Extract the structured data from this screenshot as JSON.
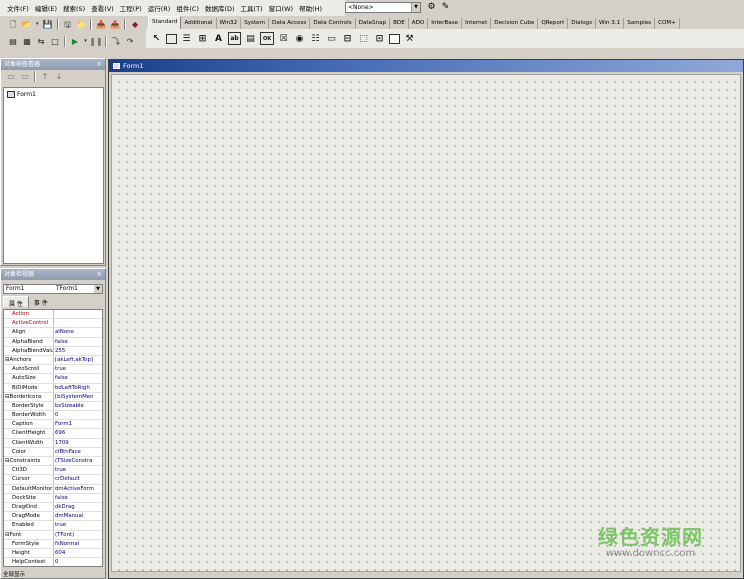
{
  "menu": [
    "文件(F)",
    "编辑(E)",
    "搜索(S)",
    "查看(V)",
    "工程(P)",
    "运行(R)",
    "组件(C)",
    "数据库(D)",
    "工具(T)",
    "窗口(W)",
    "帮助(H)"
  ],
  "desktop_combo": {
    "value": "<None>"
  },
  "palette": {
    "tabs": [
      "Standard",
      "Additional",
      "Win32",
      "System",
      "Data Access",
      "Data Controls",
      "DataSnap",
      "BDE",
      "ADO",
      "InterBase",
      "Internet",
      "Decision Cube",
      "QReport",
      "Dialogs",
      "Win 3.1",
      "Samples",
      "COM+"
    ],
    "active_tab": "Standard",
    "components": [
      "pointer-icon",
      "frames-icon",
      "main-menu-icon",
      "popup-menu-icon",
      "label-icon",
      "edit-icon",
      "memo-icon",
      "button-icon",
      "checkbox-icon",
      "radio-icon",
      "listbox-icon",
      "combobox-icon",
      "scrollbar-icon",
      "groupbox-icon",
      "radiogroup-icon",
      "panel-icon",
      "actionlist-icon"
    ],
    "label_glyph": "A",
    "edit_glyph": "ab",
    "button_glyph": "OK",
    "scrollbar_glyph": "⊟"
  },
  "tree_view": {
    "title": "对象树查看器",
    "items": [
      "Form1"
    ]
  },
  "inspector": {
    "title": "对象检视器",
    "selected_object": "Form1",
    "selected_type": "TForm1",
    "tabs": [
      "属 性",
      "事 件"
    ],
    "properties": [
      {
        "name": "Action",
        "value": "",
        "kind": "event"
      },
      {
        "name": "ActiveControl",
        "value": "",
        "kind": "event"
      },
      {
        "name": "Align",
        "value": "alNone",
        "kind": "prop"
      },
      {
        "name": "AlphaBlend",
        "value": "false",
        "kind": "prop"
      },
      {
        "name": "AlphaBlendValu",
        "value": "255",
        "kind": "prop"
      },
      {
        "name": "⊟Anchors",
        "value": "[akLeft,akTop]",
        "kind": "group"
      },
      {
        "name": "AutoScroll",
        "value": "true",
        "kind": "prop"
      },
      {
        "name": "AutoSize",
        "value": "false",
        "kind": "prop"
      },
      {
        "name": "BiDiMode",
        "value": "bdLeftToRigh",
        "kind": "prop"
      },
      {
        "name": "⊟BorderIcons",
        "value": "[biSystemMen",
        "kind": "group"
      },
      {
        "name": "BorderStyle",
        "value": "bsSizeable",
        "kind": "prop"
      },
      {
        "name": "BorderWidth",
        "value": "0",
        "kind": "prop"
      },
      {
        "name": "Caption",
        "value": "Form1",
        "kind": "selected"
      },
      {
        "name": "ClientHeight",
        "value": "696",
        "kind": "prop"
      },
      {
        "name": "ClientWidth",
        "value": "1709",
        "kind": "prop"
      },
      {
        "name": "Color",
        "value": "clBtnFace",
        "kind": "prop"
      },
      {
        "name": "⊟Constraints",
        "value": "(TSizeConstra",
        "kind": "group"
      },
      {
        "name": "Ctl3D",
        "value": "true",
        "kind": "prop"
      },
      {
        "name": "Cursor",
        "value": "crDefault",
        "kind": "prop"
      },
      {
        "name": "DefaultMonitor",
        "value": "dmActiveForm",
        "kind": "prop"
      },
      {
        "name": "DockSite",
        "value": "false",
        "kind": "prop"
      },
      {
        "name": "DragKind",
        "value": "dkDrag",
        "kind": "prop"
      },
      {
        "name": "DragMode",
        "value": "dmManual",
        "kind": "prop"
      },
      {
        "name": "Enabled",
        "value": "true",
        "kind": "prop"
      },
      {
        "name": "⊟Font",
        "value": "(TFont)",
        "kind": "group"
      },
      {
        "name": "FormStyle",
        "value": "fsNormal",
        "kind": "prop"
      },
      {
        "name": "Height",
        "value": "604",
        "kind": "prop"
      },
      {
        "name": "HelpContext",
        "value": "0",
        "kind": "prop"
      }
    ],
    "status": "全部显示"
  },
  "form": {
    "caption": "Form1"
  },
  "watermark": {
    "cn": "绿色资源网",
    "en": "www.downcc.com"
  },
  "colors": {
    "form_caption": "#1b3e8a",
    "event_text": "#a00000",
    "value_text": "#000080",
    "watermark_green": "#6fc05a"
  }
}
